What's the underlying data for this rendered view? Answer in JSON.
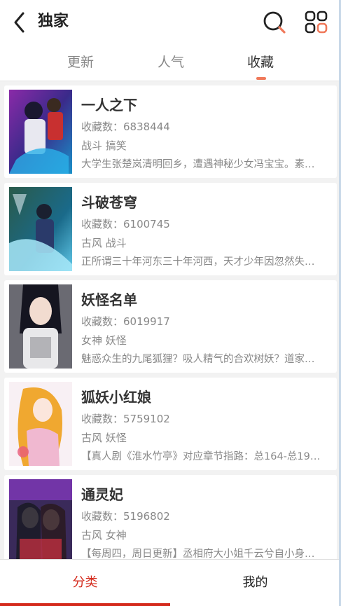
{
  "header": {
    "title": "独家",
    "back_icon": "chevron-left-icon",
    "search_icon": "search-icon",
    "menu_icon": "grid-icon",
    "accent_color": "#f0795a"
  },
  "tabs": [
    {
      "label": "更新",
      "active": false
    },
    {
      "label": "人气",
      "active": false
    },
    {
      "label": "收藏",
      "active": true
    }
  ],
  "comics": [
    {
      "title": "一人之下",
      "favorites": "收藏数：6838444",
      "tags": "战斗 搞笑",
      "description": "大学生张楚岚清明回乡，遭遇神秘少女冯宝宝。素…"
    },
    {
      "title": "斗破苍穹",
      "favorites": "收藏数：6100745",
      "tags": "古风 战斗",
      "description": "正所谓三十年河东三十年河西，天才少年因忽然失…"
    },
    {
      "title": "妖怪名单",
      "favorites": "收藏数：6019917",
      "tags": "女神 妖怪",
      "description": "魅惑众生的九尾狐狸？吸人精气的合欢树妖？道家…"
    },
    {
      "title": "狐妖小红娘",
      "favorites": "收藏数：5759102",
      "tags": "古风 妖怪",
      "description": "【真人剧《淮水竹亭》对应章节指路：总164-总19…"
    },
    {
      "title": "通灵妃",
      "favorites": "收藏数：5196802",
      "tags": "古风 女神",
      "description": "【每周四，周日更新】丞相府大小姐千云兮自小身…"
    }
  ],
  "bottom_nav": [
    {
      "label": "分类",
      "active": true,
      "color": "#d42a1c"
    },
    {
      "label": "我的",
      "active": false,
      "color": "#222222"
    }
  ]
}
